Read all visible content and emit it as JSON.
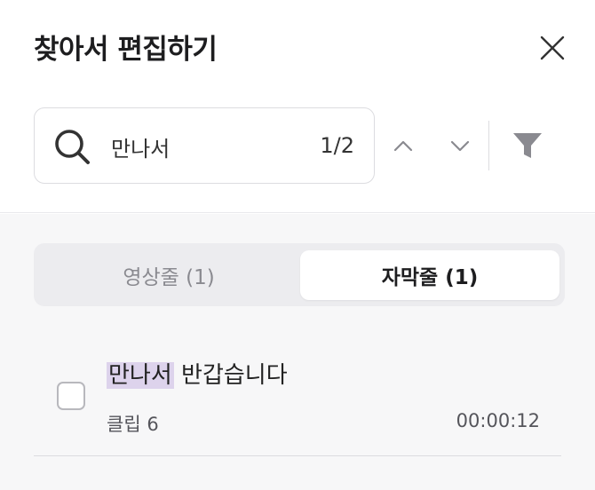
{
  "header": {
    "title": "찾아서 편집하기",
    "close_icon": "close-icon"
  },
  "search": {
    "value": "만나서",
    "placeholder": "",
    "count": "1/2",
    "icon": "search-icon"
  },
  "nav": {
    "prev_icon": "chevron-up-icon",
    "next_icon": "chevron-down-icon",
    "filter_icon": "filter-icon"
  },
  "tabs": [
    {
      "label": "영상줄 (1)",
      "selected": false
    },
    {
      "label": "자막줄 (1)",
      "selected": true
    }
  ],
  "results": [
    {
      "match": "만나서",
      "rest": " 반갑습니다",
      "clip": "클립 6",
      "time": "00:00:12",
      "checked": false
    }
  ],
  "colors": {
    "highlight": "#ddd3ec",
    "panel_bg": "#f7f7f8",
    "segment_bg": "#ececef"
  }
}
